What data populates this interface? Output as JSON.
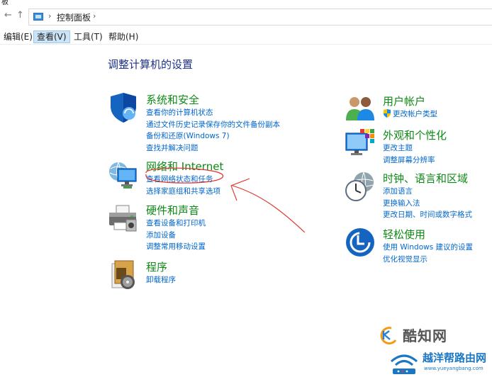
{
  "window": {
    "title_fragment": "板"
  },
  "address": {
    "back_glyph": "←",
    "up_glyph": "↑",
    "separator": "›",
    "breadcrumb": "控制面板"
  },
  "menu": [
    {
      "label": "编辑(E)"
    },
    {
      "label": "查看(V)",
      "active": true
    },
    {
      "label": "工具(T)"
    },
    {
      "label": "帮助(H)"
    }
  ],
  "page_title": "调整计算机的设置",
  "left_categories": [
    {
      "title": "系统和安全",
      "icon": "shield-icon",
      "links": [
        "查看你的计算机状态",
        "通过文件历史记录保存你的文件备份副本",
        "备份和还原(Windows 7)",
        "查找并解决问题"
      ]
    },
    {
      "title": "网络和 Internet",
      "icon": "network-icon",
      "links": [
        "查看网络状态和任务",
        "选择家庭组和共享选项"
      ]
    },
    {
      "title": "硬件和声音",
      "icon": "printer-icon",
      "links": [
        "查看设备和打印机",
        "添加设备",
        "调整常用移动设置"
      ]
    },
    {
      "title": "程序",
      "icon": "programs-icon",
      "links": [
        "卸载程序"
      ]
    }
  ],
  "right_categories": [
    {
      "title": "用户帐户",
      "icon": "users-icon",
      "links": [
        "更改帐户类型"
      ]
    },
    {
      "title": "外观和个性化",
      "icon": "appearance-icon",
      "links": [
        "更改主题",
        "调整屏幕分辨率"
      ]
    },
    {
      "title": "时钟、语言和区域",
      "icon": "clock-icon",
      "links": [
        "添加语言",
        "更换输入法",
        "更改日期、时间或数字格式"
      ]
    },
    {
      "title": "轻松使用",
      "icon": "ease-of-access-icon",
      "links": [
        "使用 Windows 建议的设置",
        "优化视觉显示"
      ]
    }
  ],
  "watermarks": {
    "zhihu": "酷知网",
    "router_title": "越洋帮路由网",
    "router_url": "www.yueyangbang.com"
  },
  "colors": {
    "category_green": "#0e8a16",
    "link_blue": "#0066cc",
    "title_navy": "#1e3287",
    "menu_active": "#cce4f7",
    "annotation_red": "#e0312a"
  }
}
